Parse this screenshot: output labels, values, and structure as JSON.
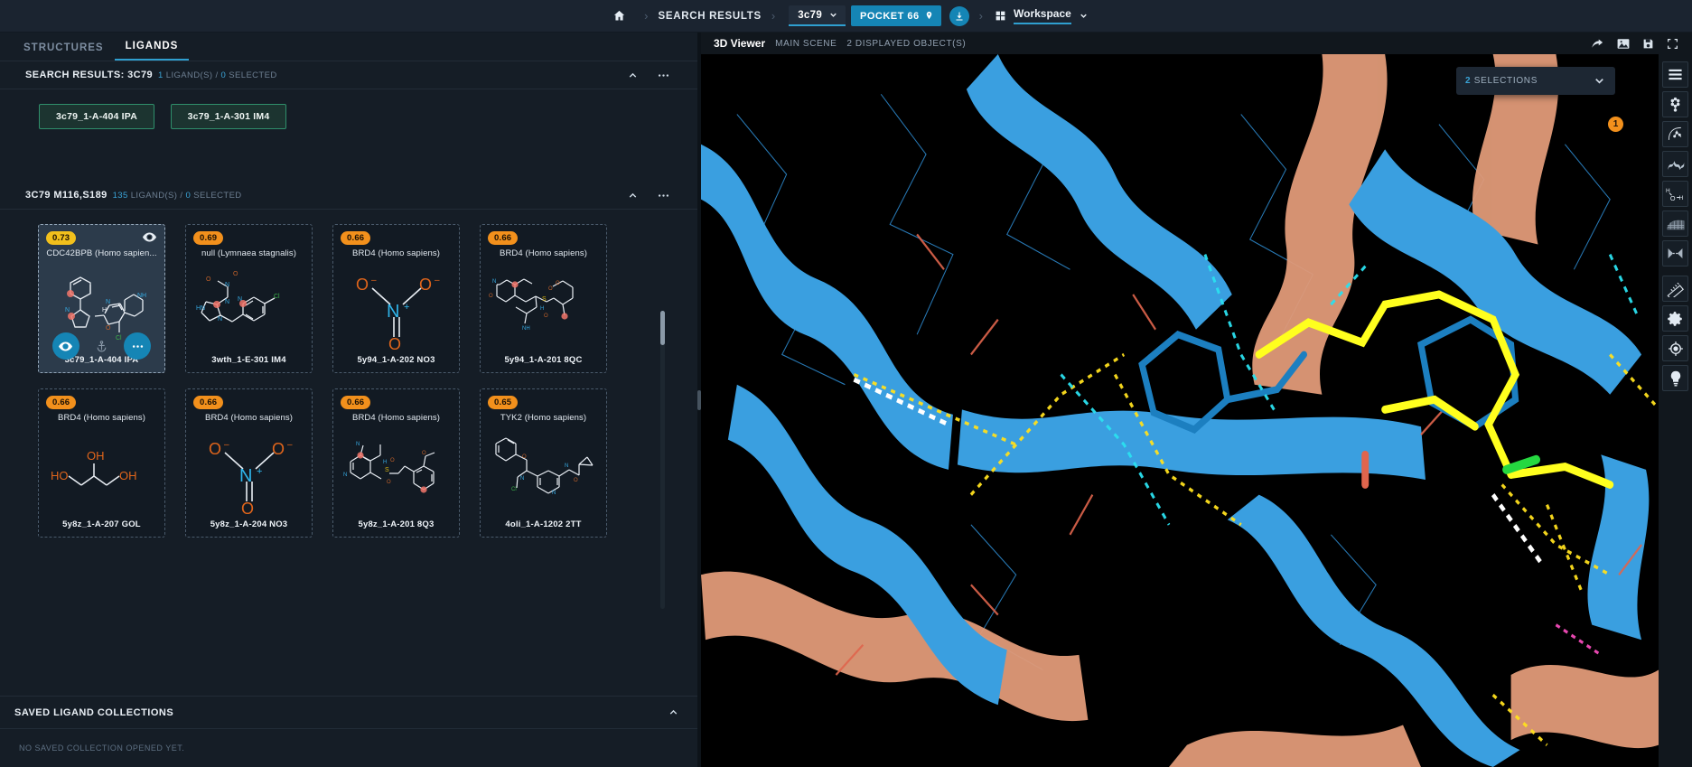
{
  "topbar": {
    "home_icon": "home-icon",
    "breadcrumb_search": "SEARCH RESULTS",
    "structure_chip": "3c79",
    "pocket_chip": "POCKET 66",
    "pocket_icon": "map-pin-icon",
    "download_icon": "download-icon",
    "workspace_icon": "grid-icon",
    "workspace_label": "Workspace",
    "chevron_icon": "chevron-down-icon",
    "separator": "›"
  },
  "tabs": [
    {
      "label": "STRUCTURES",
      "active": false
    },
    {
      "label": "LIGANDS",
      "active": true
    }
  ],
  "search_section": {
    "title": "SEARCH RESULTS: 3C79",
    "count": "1",
    "meta_mid": "LIGAND(S) /",
    "selected": "0",
    "meta_end": "SELECTED",
    "collapse_icon": "chevron-up-icon",
    "more_icon": "more-horizontal-icon",
    "hits": [
      {
        "label": "3c79_1-A-404 IPA"
      },
      {
        "label": "3c79_1-A-301 IM4"
      }
    ]
  },
  "results_section": {
    "title": "3C79 M116,S189",
    "count": "135",
    "meta_mid": "LIGAND(S) /",
    "selected": "0",
    "meta_end": "SELECTED",
    "collapse_icon": "chevron-up-icon",
    "more_icon": "more-horizontal-icon",
    "cards": [
      {
        "score": "0.73",
        "title": "CDC42BPB (Homo sapien...",
        "code": "3c79_1-A-404 IPA",
        "selected": true,
        "score_color": "#f2c01c",
        "mol": "cdc42",
        "actions": [
          {
            "icon": "eye-icon",
            "style": "blue"
          },
          {
            "icon": "anchor-icon",
            "style": "ghost"
          },
          {
            "icon": "more-icon",
            "style": "blue"
          }
        ]
      },
      {
        "score": "0.69",
        "title": "null (Lymnaea stagnalis)",
        "code": "3wth_1-E-301 IM4",
        "selected": false,
        "score_color": "#f2901c",
        "mol": "nitroimid"
      },
      {
        "score": "0.66",
        "title": "BRD4 (Homo sapiens)",
        "code": "5y94_1-A-202 NO3",
        "selected": false,
        "score_color": "#f2901c",
        "mol": "nitrate"
      },
      {
        "score": "0.66",
        "title": "BRD4 (Homo sapiens)",
        "code": "5y94_1-A-201 8QC",
        "selected": false,
        "score_color": "#f2901c",
        "mol": "sulfonamide"
      },
      {
        "score": "0.66",
        "title": "BRD4 (Homo sapiens)",
        "code": "5y8z_1-A-207 GOL",
        "selected": false,
        "score_color": "#f2901c",
        "mol": "glycerol"
      },
      {
        "score": "0.66",
        "title": "BRD4 (Homo sapiens)",
        "code": "5y8z_1-A-204 NO3",
        "selected": false,
        "score_color": "#f2901c",
        "mol": "nitrate"
      },
      {
        "score": "0.66",
        "title": "BRD4 (Homo sapiens)",
        "code": "5y8z_1-A-201 8Q3",
        "selected": false,
        "score_color": "#f2901c",
        "mol": "sulfonamide2"
      },
      {
        "score": "0.65",
        "title": "TYK2 (Homo sapiens)",
        "code": "4oli_1-A-1202 2TT",
        "selected": false,
        "score_color": "#f2901c",
        "mol": "tyk2"
      }
    ]
  },
  "saved_section": {
    "title": "SAVED LIGAND COLLECTIONS",
    "collapse_icon": "chevron-up-icon",
    "empty_text": "NO SAVED COLLECTION OPENED YET."
  },
  "viewer": {
    "title": "3D Viewer",
    "scene": "MAIN SCENE",
    "objects": "2 DISPLAYED OBJECT(S)",
    "header_icons": [
      "reset-view-icon",
      "image-icon",
      "save-icon",
      "fullscreen-icon"
    ],
    "selection_count": "2",
    "selection_label": "SELECTIONS",
    "selection_badge": "1",
    "selection_chevron": "chevron-down-icon",
    "tools": [
      "layers-icon",
      "molecule-icon",
      "pocket-surface-icon",
      "ribbon-icon",
      "water-icon",
      "mesh-surface-icon",
      "interaction-icon",
      "ruler-icon",
      "gear-icon",
      "target-icon",
      "bulb-icon"
    ]
  },
  "colors": {
    "accent": "#2f9fd0",
    "accent_fill": "#1585b5",
    "orange": "#f2901c",
    "yellow": "#f2c01c",
    "green": "#2f8f6b",
    "panel_bg": "#151d26",
    "topbar_bg": "#1b2430",
    "canvas_bg": "#000000",
    "protein_blue": "#3a9fe0",
    "protein_salmon": "#e2a183",
    "ligand_yellow": "#ffff1e"
  }
}
